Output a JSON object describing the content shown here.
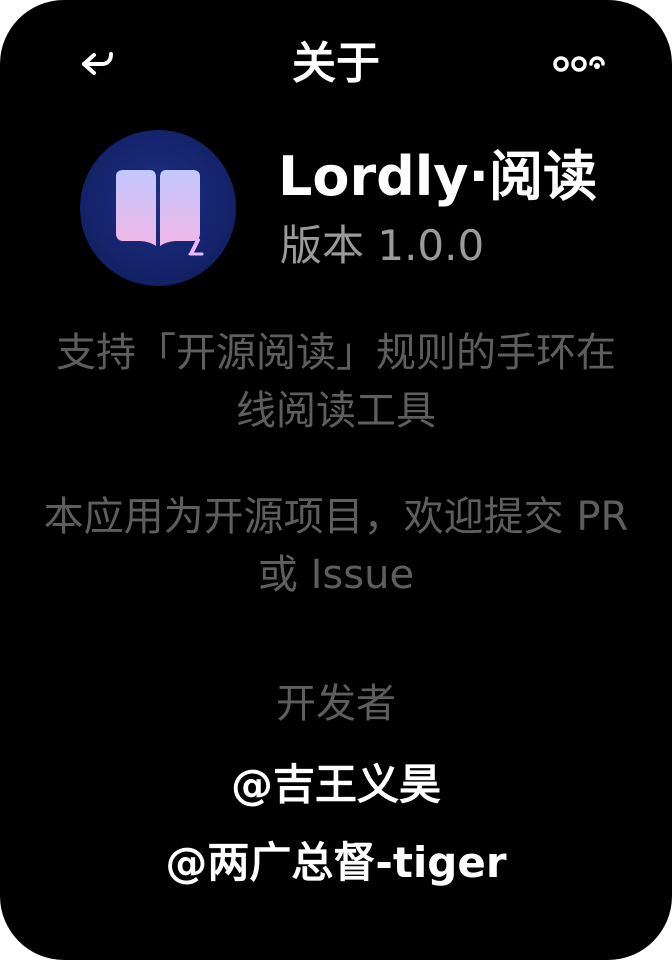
{
  "header": {
    "title": "关于",
    "back_icon": "back-arrow-icon",
    "more_icon": "more-dots-icon"
  },
  "app": {
    "name": "Lordly·阅读",
    "version": "版本 1.0.0",
    "icon": "book-logo-icon",
    "icon_color": "#1a2a78"
  },
  "description": {
    "line1": "支持「开源阅读」规则的手环在线阅读工具",
    "line2": "本应用为开源项目，欢迎提交 PR 或 Issue"
  },
  "developers": {
    "title": "开发者",
    "items": [
      "@吉王义昊",
      "@两广总督-tiger"
    ]
  },
  "colors": {
    "background": "#000000",
    "primary_text": "#ffffff",
    "secondary_text": "#9a9a9a",
    "muted_text": "#5e5e5e"
  }
}
